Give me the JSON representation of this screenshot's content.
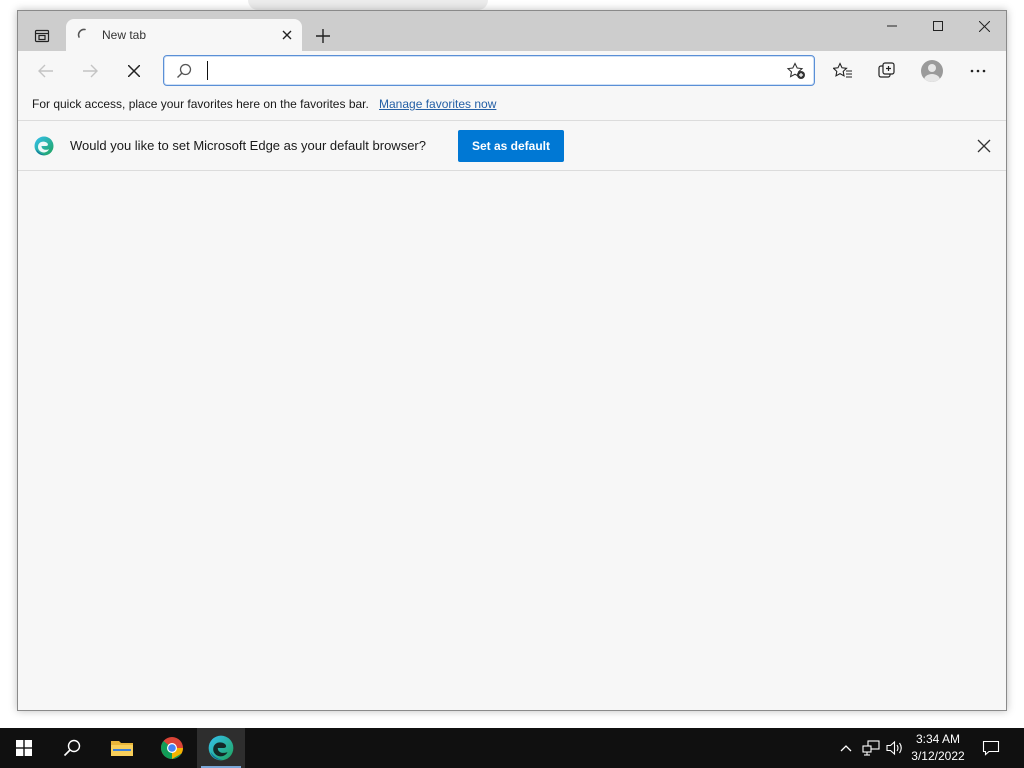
{
  "browser": {
    "tab": {
      "title": "New tab"
    },
    "address_bar": {
      "value": "",
      "placeholder": ""
    },
    "favorites_bar": {
      "message": "For quick access, place your favorites here on the favorites bar.",
      "link": "Manage favorites now"
    },
    "infobar": {
      "message": "Would you like to set Microsoft Edge as your default browser?",
      "button": "Set as default"
    }
  },
  "taskbar": {
    "time": "3:34 AM",
    "date": "3/12/2022",
    "apps": [
      "windows-start",
      "search",
      "file-explorer",
      "google-chrome",
      "microsoft-edge"
    ]
  },
  "colors": {
    "accent": "#0078d4",
    "link": "#2560a6",
    "titlebar": "#cdcdcd",
    "page_background": "#f7f7f7",
    "taskbar": "#101010"
  },
  "icons": [
    "tab-actions-icon",
    "loading-spinner-icon",
    "close-icon",
    "plus-icon",
    "minimize-icon",
    "maximize-icon",
    "back-arrow-icon",
    "forward-arrow-icon",
    "stop-icon",
    "search-icon",
    "add-favorite-icon",
    "favorites-icon",
    "collections-icon",
    "profile-icon",
    "more-icon",
    "edge-logo-icon"
  ]
}
